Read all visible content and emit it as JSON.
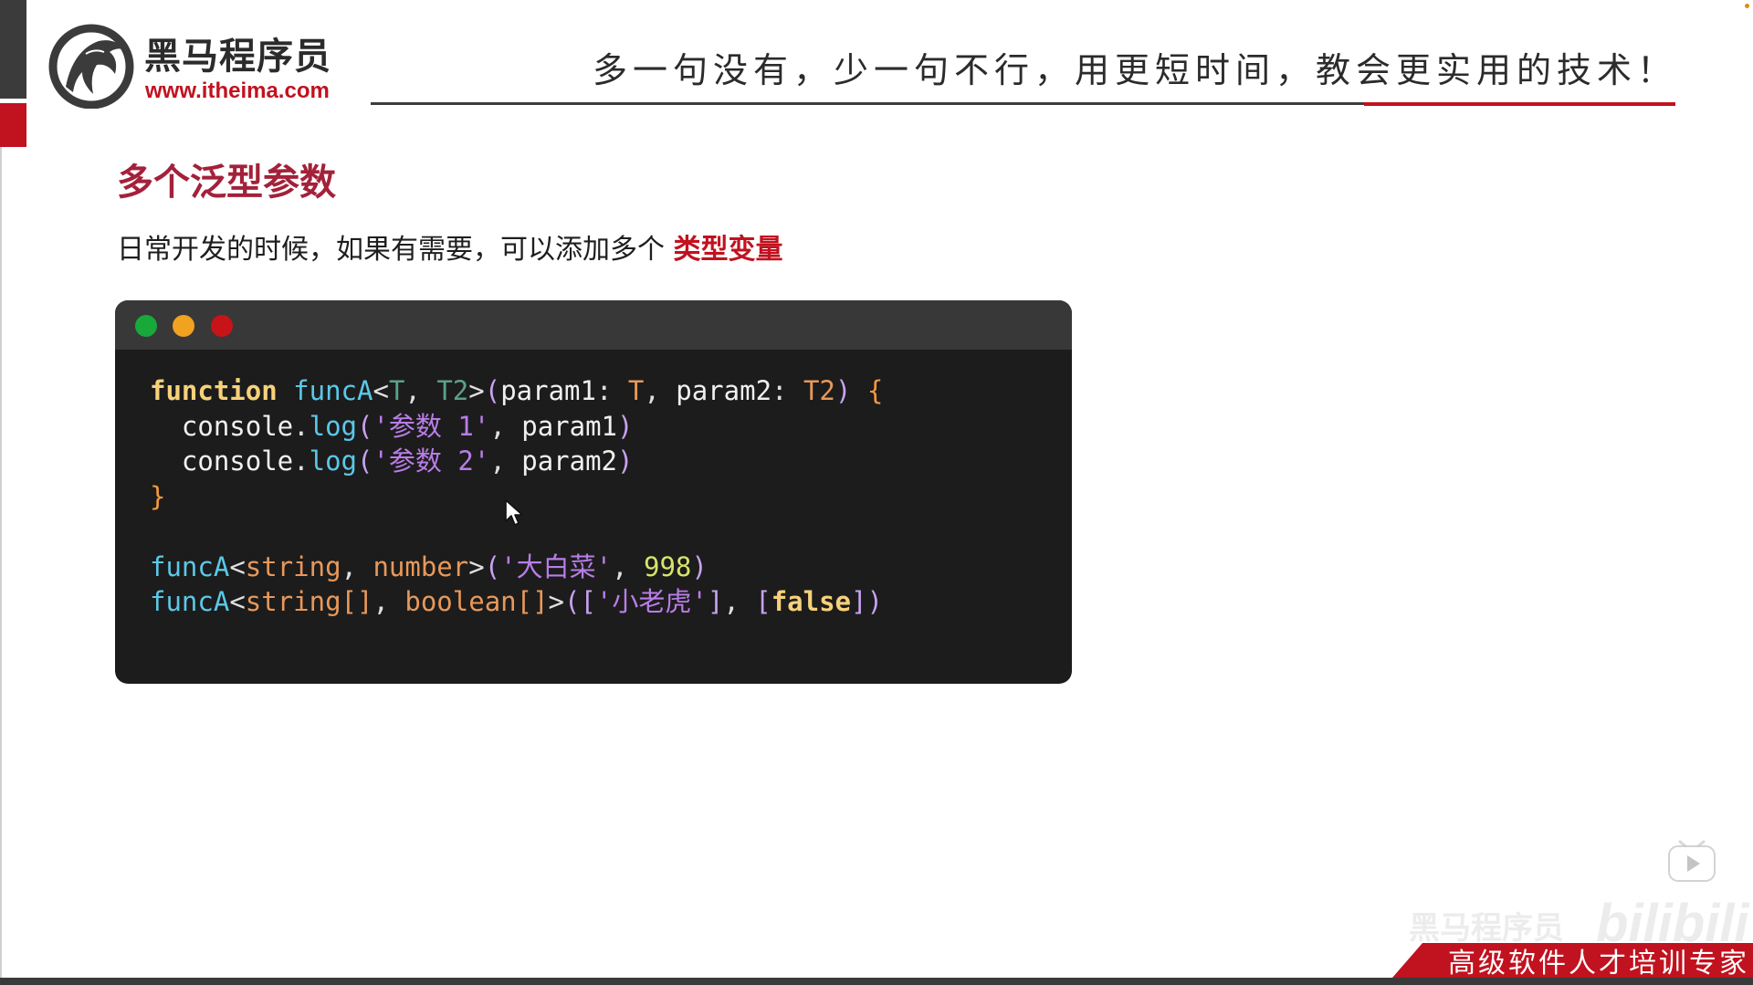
{
  "header": {
    "brand_cn": "黑马程序员",
    "brand_url": "www.itheima.com",
    "slogan": "多一句没有，少一句不行，用更短时间，教会更实用的技术！"
  },
  "section": {
    "title": "多个泛型参数",
    "desc_main": "日常开发的时候，如果有需要，可以添加多个 ",
    "desc_highlight": "类型变量"
  },
  "code": {
    "lines": [
      [
        {
          "t": "function",
          "c": "kw"
        },
        {
          "t": " ",
          "c": ""
        },
        {
          "t": "funcA",
          "c": "fn"
        },
        {
          "t": "<",
          "c": "pu"
        },
        {
          "t": "T",
          "c": "gt"
        },
        {
          "t": ", ",
          "c": "pu"
        },
        {
          "t": "T2",
          "c": "gt"
        },
        {
          "t": ">",
          "c": "pu"
        },
        {
          "t": "(",
          "c": "br"
        },
        {
          "t": "param1",
          "c": ""
        },
        {
          "t": ": ",
          "c": "pu"
        },
        {
          "t": "T",
          "c": "ty"
        },
        {
          "t": ", ",
          "c": "pu"
        },
        {
          "t": "param2",
          "c": ""
        },
        {
          "t": ": ",
          "c": "pu"
        },
        {
          "t": "T2",
          "c": "ty"
        },
        {
          "t": ")",
          "c": "br"
        },
        {
          "t": " ",
          "c": ""
        },
        {
          "t": "{",
          "c": "cb"
        }
      ],
      [
        {
          "t": "  console",
          "c": ""
        },
        {
          "t": ".",
          "c": "pu"
        },
        {
          "t": "log",
          "c": "fn"
        },
        {
          "t": "(",
          "c": "br"
        },
        {
          "t": "'参数 1'",
          "c": "st"
        },
        {
          "t": ", ",
          "c": "pu"
        },
        {
          "t": "param1",
          "c": ""
        },
        {
          "t": ")",
          "c": "br"
        }
      ],
      [
        {
          "t": "  console",
          "c": ""
        },
        {
          "t": ".",
          "c": "pu"
        },
        {
          "t": "log",
          "c": "fn"
        },
        {
          "t": "(",
          "c": "br"
        },
        {
          "t": "'参数 2'",
          "c": "st"
        },
        {
          "t": ", ",
          "c": "pu"
        },
        {
          "t": "param2",
          "c": ""
        },
        {
          "t": ")",
          "c": "br"
        }
      ],
      [
        {
          "t": "}",
          "c": "cb"
        }
      ],
      [],
      [
        {
          "t": "funcA",
          "c": "fn"
        },
        {
          "t": "<",
          "c": "pu"
        },
        {
          "t": "string",
          "c": "ty"
        },
        {
          "t": ", ",
          "c": "pu"
        },
        {
          "t": "number",
          "c": "ty"
        },
        {
          "t": ">",
          "c": "pu"
        },
        {
          "t": "(",
          "c": "br"
        },
        {
          "t": "'大白菜'",
          "c": "st"
        },
        {
          "t": ", ",
          "c": "pu"
        },
        {
          "t": "998",
          "c": "nm"
        },
        {
          "t": ")",
          "c": "br"
        }
      ],
      [
        {
          "t": "funcA",
          "c": "fn"
        },
        {
          "t": "<",
          "c": "pu"
        },
        {
          "t": "string[]",
          "c": "ty"
        },
        {
          "t": ", ",
          "c": "pu"
        },
        {
          "t": "boolean[]",
          "c": "ty"
        },
        {
          "t": ">",
          "c": "pu"
        },
        {
          "t": "(",
          "c": "br"
        },
        {
          "t": "[",
          "c": "br"
        },
        {
          "t": "'小老虎'",
          "c": "st"
        },
        {
          "t": "]",
          "c": "br"
        },
        {
          "t": ", ",
          "c": "pu"
        },
        {
          "t": "[",
          "c": "br"
        },
        {
          "t": "false",
          "c": "kw"
        },
        {
          "t": "]",
          "c": "br"
        },
        {
          "t": ")",
          "c": "br"
        }
      ]
    ]
  },
  "footer": {
    "watermark_text": "黑马程序员",
    "watermark_logo": "bilibili",
    "banner_text": "高级软件人才培训专家"
  },
  "colors": {
    "accent_red": "#c1121f",
    "title_red": "#a3213a",
    "code_bg": "#1c1c1c",
    "code_bar": "#383838"
  },
  "icons": [
    "horse-logo-icon",
    "traffic-light-icon",
    "mouse-cursor-icon",
    "play-icon"
  ]
}
